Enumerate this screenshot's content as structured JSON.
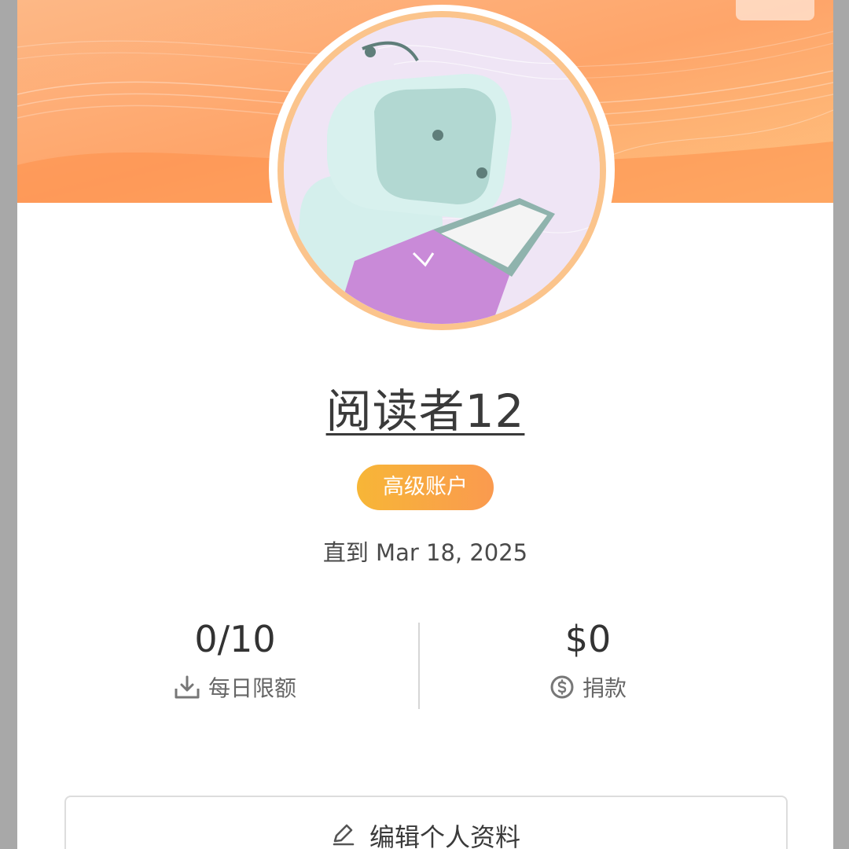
{
  "profile": {
    "username": "阅读者12",
    "badge": "高级账户",
    "until": "直到 Mar 18, 2025"
  },
  "stats": {
    "quota": {
      "value": "0/10",
      "label": "每日限额",
      "icon": "download-icon"
    },
    "donation": {
      "value": "$0",
      "label": "捐款",
      "icon": "dollar-circle-icon"
    }
  },
  "actions": {
    "edit_profile": {
      "label": "编辑个人资料",
      "icon": "pencil-icon"
    }
  },
  "colors": {
    "banner_start": "#fdb27a",
    "banner_end": "#fd9a52",
    "badge_start": "#f7b637",
    "badge_end": "#fa9a4f",
    "avatar_ring": "#fbc48c"
  }
}
